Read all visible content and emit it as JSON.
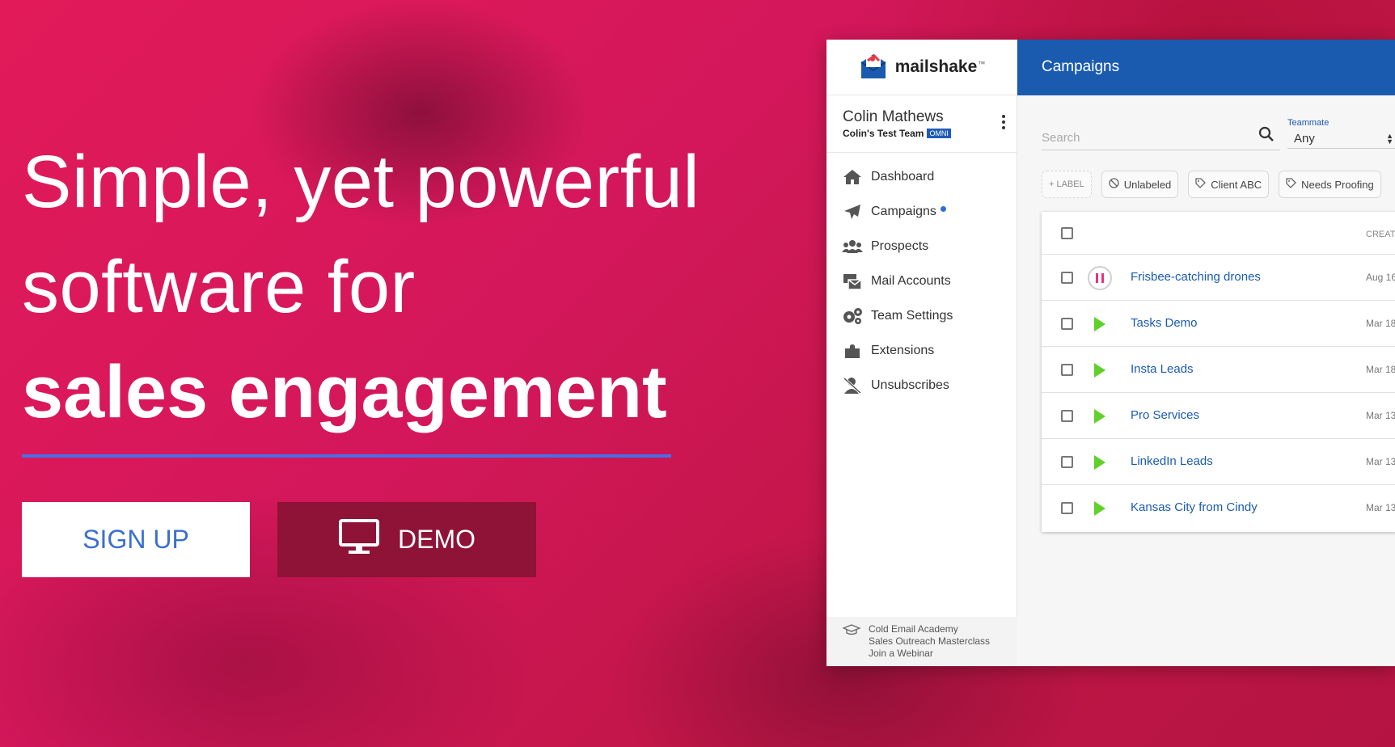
{
  "hero": {
    "line1": "Simple, yet powerful",
    "line2": "software for",
    "line3": "sales engagement",
    "signup_label": "SIGN UP",
    "demo_label": "DEMO"
  },
  "app": {
    "logo": "mailshake",
    "logo_tm": "™",
    "user": {
      "name": "Colin Mathews",
      "team": "Colin's Test Team",
      "badge": "OMNI"
    },
    "nav": [
      {
        "label": "Dashboard",
        "icon": "home-icon"
      },
      {
        "label": "Campaigns",
        "icon": "paper-plane-icon"
      },
      {
        "label": "Prospects",
        "icon": "users-icon"
      },
      {
        "label": "Mail Accounts",
        "icon": "mail-accounts-icon"
      },
      {
        "label": "Team Settings",
        "icon": "gears-icon"
      },
      {
        "label": "Extensions",
        "icon": "puzzle-icon"
      },
      {
        "label": "Unsubscribes",
        "icon": "user-slash-icon"
      }
    ],
    "footer": {
      "links": [
        "Cold Email Academy",
        "Sales Outreach Masterclass",
        "Join a Webinar"
      ],
      "icon": "graduation-cap-icon"
    },
    "header_title": "Campaigns",
    "search": {
      "placeholder": "Search"
    },
    "teammate": {
      "label": "Teammate",
      "value": "Any"
    },
    "chips": {
      "add_label": "+ LABEL",
      "items": [
        "Unlabeled",
        "Client ABC",
        "Needs Proofing"
      ]
    },
    "table": {
      "col_created": "CREAT",
      "rows": [
        {
          "name": "Frisbee-catching drones",
          "date": "Aug 16",
          "status": "paused"
        },
        {
          "name": "Tasks Demo",
          "date": "Mar 18",
          "status": "active"
        },
        {
          "name": "Insta Leads",
          "date": "Mar 18",
          "status": "active"
        },
        {
          "name": "Pro Services",
          "date": "Mar 13",
          "status": "active"
        },
        {
          "name": "LinkedIn Leads",
          "date": "Mar 13",
          "status": "active"
        },
        {
          "name": "Kansas City from Cindy",
          "date": "Mar 13",
          "status": "active"
        }
      ]
    }
  },
  "colors": {
    "background": "#c8164a",
    "accent_blue": "#1a5bb0",
    "underline": "#4a6ee8",
    "play_green": "#5fd12a",
    "pause_pink": "#e8337a",
    "demo_button": "#8e1336"
  }
}
